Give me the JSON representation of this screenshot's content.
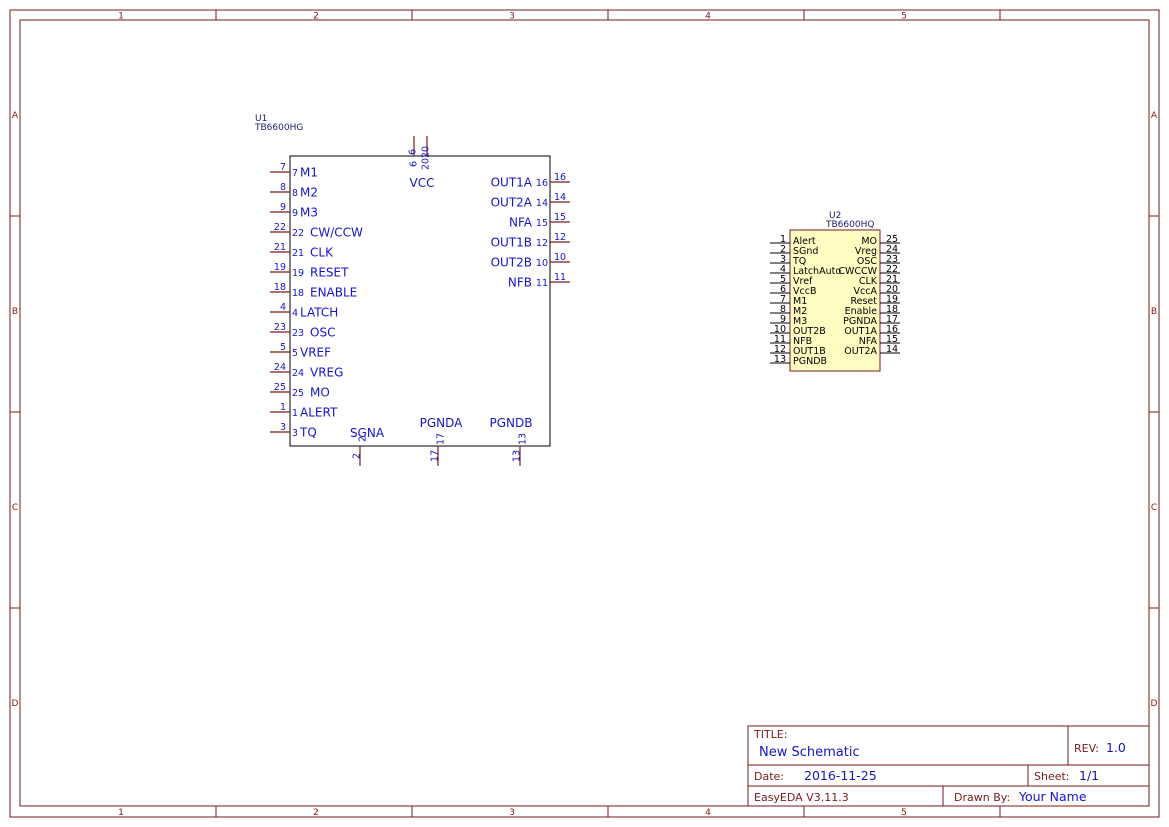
{
  "sheet": {
    "columns": [
      "1",
      "2",
      "3",
      "4",
      "5"
    ],
    "rows": [
      "A",
      "B",
      "C",
      "D"
    ]
  },
  "title_block": {
    "title_label": "TITLE:",
    "title": "New Schematic",
    "rev_label": "REV:",
    "rev": "1.0",
    "date_label": "Date:",
    "date": "2016-11-25",
    "sheet_label": "Sheet:",
    "sheet": "1/1",
    "tool": "EasyEDA V3.11.3",
    "drawn_by_label": "Drawn By:",
    "drawn_by": "Your Name"
  },
  "components": {
    "u1": {
      "designator": "U1",
      "part": "TB6600HG",
      "left_pins": [
        {
          "num": "7",
          "name": "M1"
        },
        {
          "num": "8",
          "name": "M2"
        },
        {
          "num": "9",
          "name": "M3"
        },
        {
          "num": "22",
          "name": "CW/CCW"
        },
        {
          "num": "21",
          "name": "CLK"
        },
        {
          "num": "19",
          "name": "RESET"
        },
        {
          "num": "18",
          "name": "ENABLE"
        },
        {
          "num": "4",
          "name": "LATCH"
        },
        {
          "num": "23",
          "name": "OSC"
        },
        {
          "num": "5",
          "name": "VREF"
        },
        {
          "num": "24",
          "name": "VREG"
        },
        {
          "num": "25",
          "name": "MO"
        },
        {
          "num": "1",
          "name": "ALERT"
        },
        {
          "num": "3",
          "name": "TQ"
        }
      ],
      "right_pins": [
        {
          "num": "16",
          "name": "OUT1A"
        },
        {
          "num": "14",
          "name": "OUT2A"
        },
        {
          "num": "15",
          "name": "NFA"
        },
        {
          "num": "12",
          "name": "OUT1B"
        },
        {
          "num": "10",
          "name": "OUT2B"
        },
        {
          "num": "11",
          "name": "NFB"
        }
      ],
      "top_pins": [
        {
          "num": "6",
          "name": "VCC"
        },
        {
          "num": "20",
          "name": ""
        }
      ],
      "bottom_pins": [
        {
          "num": "2",
          "name": "SGNA"
        },
        {
          "num": "17",
          "name": "PGNDA"
        },
        {
          "num": "13",
          "name": "PGNDB"
        }
      ]
    },
    "u2": {
      "designator": "U2",
      "part": "TB6600HQ",
      "left_pins": [
        {
          "num": "1",
          "name": "Alert"
        },
        {
          "num": "2",
          "name": "SGnd"
        },
        {
          "num": "3",
          "name": "TQ"
        },
        {
          "num": "4",
          "name": "LatchAuto"
        },
        {
          "num": "5",
          "name": "Vref"
        },
        {
          "num": "6",
          "name": "VccB"
        },
        {
          "num": "7",
          "name": "M1"
        },
        {
          "num": "8",
          "name": "M2"
        },
        {
          "num": "9",
          "name": "M3"
        },
        {
          "num": "10",
          "name": "OUT2B"
        },
        {
          "num": "11",
          "name": "NFB"
        },
        {
          "num": "12",
          "name": "OUT1B"
        },
        {
          "num": "13",
          "name": "PGNDB"
        }
      ],
      "right_pins": [
        {
          "num": "25",
          "name": "MO"
        },
        {
          "num": "24",
          "name": "Vreg"
        },
        {
          "num": "23",
          "name": "OSC"
        },
        {
          "num": "22",
          "name": "CWCCW"
        },
        {
          "num": "21",
          "name": "CLK"
        },
        {
          "num": "20",
          "name": "VccA"
        },
        {
          "num": "19",
          "name": "Reset"
        },
        {
          "num": "18",
          "name": "Enable"
        },
        {
          "num": "17",
          "name": "PGNDA"
        },
        {
          "num": "16",
          "name": "OUT1A"
        },
        {
          "num": "15",
          "name": "NFA"
        },
        {
          "num": "14",
          "name": "OUT2A"
        }
      ]
    }
  },
  "colors": {
    "frame": "#7a1a1a",
    "u1_text": "#1515c8",
    "u1_pin": "#7a1a1a",
    "u2_fill": "#fffdc2",
    "u2_outline": "#7a1a1a"
  }
}
